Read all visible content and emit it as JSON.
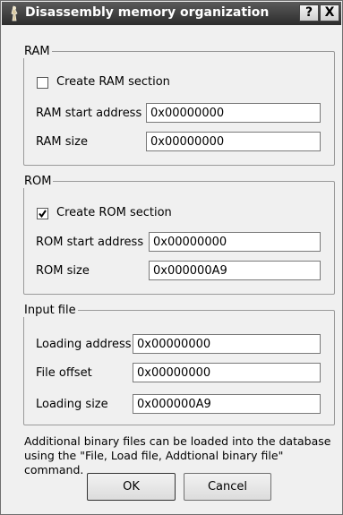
{
  "window": {
    "title": "Disassembly memory organization",
    "help_label": "?",
    "close_label": "X"
  },
  "ram": {
    "legend": "RAM",
    "create_label": "Create RAM section",
    "create_checked": false,
    "start_label": "RAM start address",
    "start_value": "0x00000000",
    "size_label": "RAM size",
    "size_value": "0x00000000"
  },
  "rom": {
    "legend": "ROM",
    "create_label": "Create ROM section",
    "create_checked": true,
    "start_label": "ROM start address",
    "start_value": "0x00000000",
    "size_label": "ROM size",
    "size_value": "0x000000A9"
  },
  "input_file": {
    "legend": "Input file",
    "loading_address_label": "Loading address",
    "loading_address_value": "0x00000000",
    "file_offset_label": "File offset",
    "file_offset_value": "0x00000000",
    "loading_size_label": "Loading size",
    "loading_size_value": "0x000000A9"
  },
  "note": "Additional binary files can be loaded into the database using the \"File, Load file, Addtional binary file\" command.",
  "buttons": {
    "ok_label": "OK",
    "cancel_label": "Cancel"
  }
}
